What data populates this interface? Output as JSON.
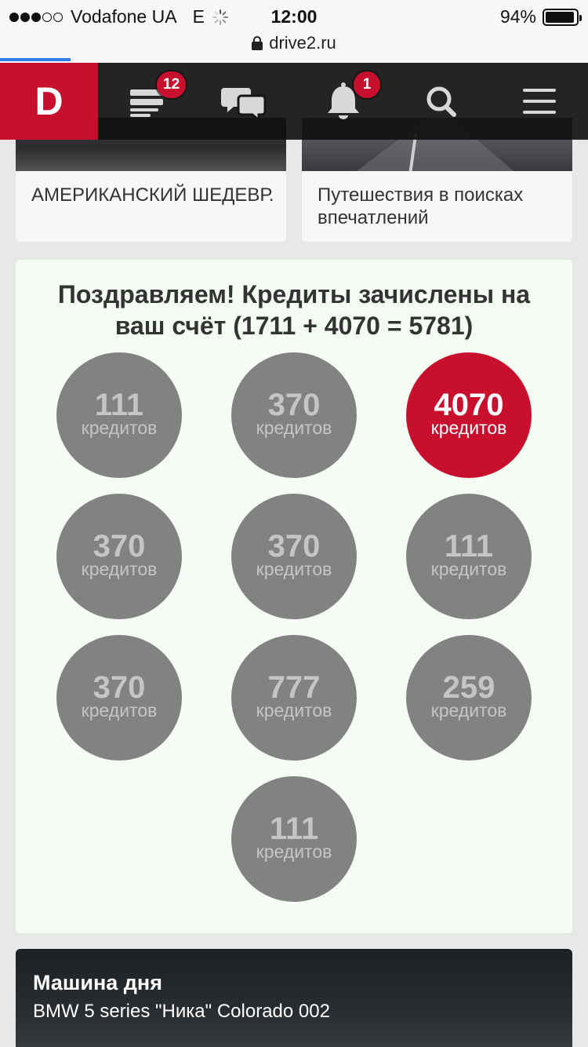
{
  "status_bar": {
    "carrier": "Vodafone UA",
    "network": "E",
    "time": "12:00",
    "battery": "94%",
    "battery_level": 0.94,
    "signal_bars_filled": 3,
    "signal_bars_total": 5
  },
  "browser": {
    "url": "drive2.ru"
  },
  "nav": {
    "logo": "D",
    "feed_badge": "12",
    "notifications_badge": "1"
  },
  "cards": [
    {
      "title": "АМЕРИКАНСКИЙ ШЕДЕВР."
    },
    {
      "title": "Путешествия в поисках впечатлений"
    }
  ],
  "credits": {
    "title": "Поздравляем! Кредиты зачислены на ваш счёт (1711 + 4070 = 5781)",
    "items": [
      {
        "value": "111",
        "unit": "кредитов",
        "active": false
      },
      {
        "value": "370",
        "unit": "кредитов",
        "active": false
      },
      {
        "value": "4070",
        "unit": "кредитов",
        "active": true
      },
      {
        "value": "370",
        "unit": "кредитов",
        "active": false
      },
      {
        "value": "370",
        "unit": "кредитов",
        "active": false
      },
      {
        "value": "111",
        "unit": "кредитов",
        "active": false
      },
      {
        "value": "370",
        "unit": "кредитов",
        "active": false
      },
      {
        "value": "777",
        "unit": "кредитов",
        "active": false
      },
      {
        "value": "259",
        "unit": "кредитов",
        "active": false
      },
      {
        "value": "111",
        "unit": "кредитов",
        "active": false
      }
    ]
  },
  "car_of_day": {
    "title": "Машина дня",
    "subtitle": "BMW 5 series \"Ника\" Colorado 002"
  },
  "colors": {
    "accent": "#c8102e",
    "coin_inactive": "#828282",
    "panel_bg": "#f5fcf4"
  }
}
